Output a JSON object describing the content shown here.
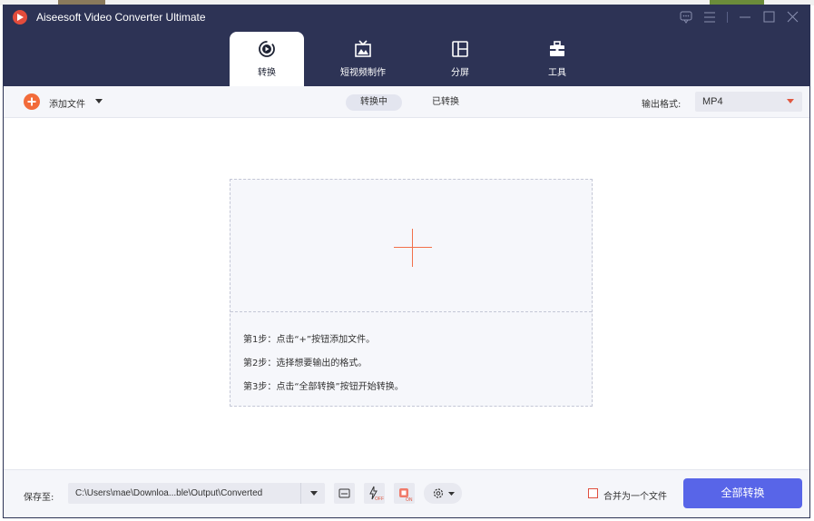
{
  "window": {
    "title": "Aiseesoft Video Converter Ultimate"
  },
  "titlebar_icons": [
    "feedback-icon",
    "menu-icon",
    "minimize-icon",
    "maximize-icon",
    "close-icon"
  ],
  "nav": {
    "tabs": [
      {
        "label": "转换",
        "icon": "convert-icon",
        "active": true
      },
      {
        "label": "短视频制作",
        "icon": "mv-icon",
        "active": false
      },
      {
        "label": "分屏",
        "icon": "collage-icon",
        "active": false
      },
      {
        "label": "工具",
        "icon": "toolbox-icon",
        "active": false
      }
    ]
  },
  "toolbar": {
    "add_files_label": "添加文件",
    "converting_tab": "转换中",
    "converted_tab": "已转换",
    "output_format_label": "输出格式:",
    "output_format_value": "MP4"
  },
  "dropzone": {
    "steps": [
      "第1步：点击“+”按钮添加文件。",
      "第2步：选择想要输出的格式。",
      "第3步：点击“全部转换”按钮开始转换。"
    ]
  },
  "bottom": {
    "save_to_label": "保存至:",
    "save_path": "C:\\Users\\mae\\Downloa...ble\\Output\\Converted",
    "merge_label": "合并为一个文件",
    "convert_all_label": "全部转换"
  },
  "colors": {
    "header_bg": "#2d3355",
    "accent_orange": "#f26b3a",
    "primary_button": "#5865e8"
  }
}
